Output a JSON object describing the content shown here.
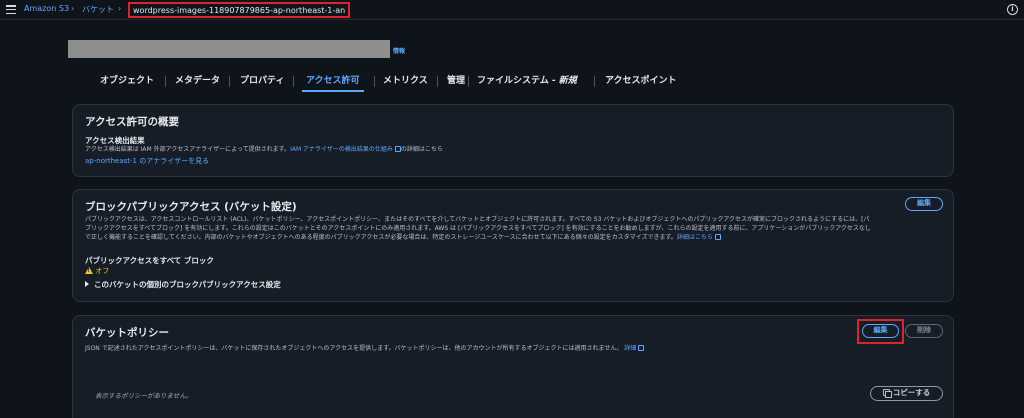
{
  "breadcrumb": {
    "items": [
      "Amazon S3",
      "バケット"
    ],
    "current": "wordpress-images-118907879865-ap-northeast-1-an"
  },
  "header": {
    "info_link": "情報"
  },
  "tabs": [
    {
      "label": "オブジェクト"
    },
    {
      "label": "メタデータ"
    },
    {
      "label": "プロパティ"
    },
    {
      "label": "アクセス許可",
      "active": true
    },
    {
      "label": "メトリクス"
    },
    {
      "label": "管理"
    },
    {
      "label": "ファイルシステム - ",
      "suffix": "新規"
    },
    {
      "label": "アクセスポイント"
    }
  ],
  "access_overview": {
    "title": "アクセス許可の概要",
    "subtitle": "アクセス検出結果",
    "desc_prefix": "アクセス検出結果は IAM 外部アクセスアナライザーによって提供されます。",
    "desc_link": "IAM アナライザーの検出結果の仕組み",
    "desc_suffix": "の詳細はこちら",
    "analyzer_link": "ap-northeast-1 のアナライザーを見る"
  },
  "block_public_access": {
    "title": "ブロックパブリックアクセス (バケット設定)",
    "edit_label": "編集",
    "desc_line1": "パブリックアクセスは、アクセスコントロールリスト (ACL)、バケットポリシー、アクセスポイントポリシー、またはそのすべてを介してバケットとオブジェクトに許可されます。すべての S3 バケットおよびオブジェクトへのパブリックアクセスが確実にブロックされるようにするには、[パ",
    "desc_line2": "ブリックアクセスをすべてブロック] を有効にします。これらの設定はこのバケットとそのアクセスポイントにのみ適用されます。AWS は [パブリックアクセスをすべてブロック] を有効にすることをお勧めしますが、これらの設定を適用する前に、アプリケーションがパブリックアクセスなし",
    "desc_line3": "で正しく機能することを確認してください。内部のバケットやオブジェクトへのある程度のパブリックアクセスが必要な場合は、特定のストレージユースケースに合わせて以下にある個々の設定をカスタマイズできます。",
    "desc_link": "詳細はこちら",
    "block_all_label": "パブリックアクセスをすべて ブロック",
    "status": "オフ",
    "expand_label": "このバケットの個別のブロックパブリックアクセス設定"
  },
  "bucket_policy": {
    "title": "バケットポリシー",
    "edit_label": "編集",
    "delete_label": "削除",
    "desc": "JSON で記述されたアクセスポイントポリシーは、バケットに保存されたオブジェクトへのアクセスを提供します。バケットポリシーは、他のアカウントが所有するオブジェクトには適用されません。",
    "desc_link": "詳細",
    "empty": "表示するポリシーがありません。",
    "copy_label": "コピーする"
  },
  "colors": {
    "accent": "#5ea8ff",
    "highlight": "#e0222a",
    "warning": "#f5c518"
  }
}
